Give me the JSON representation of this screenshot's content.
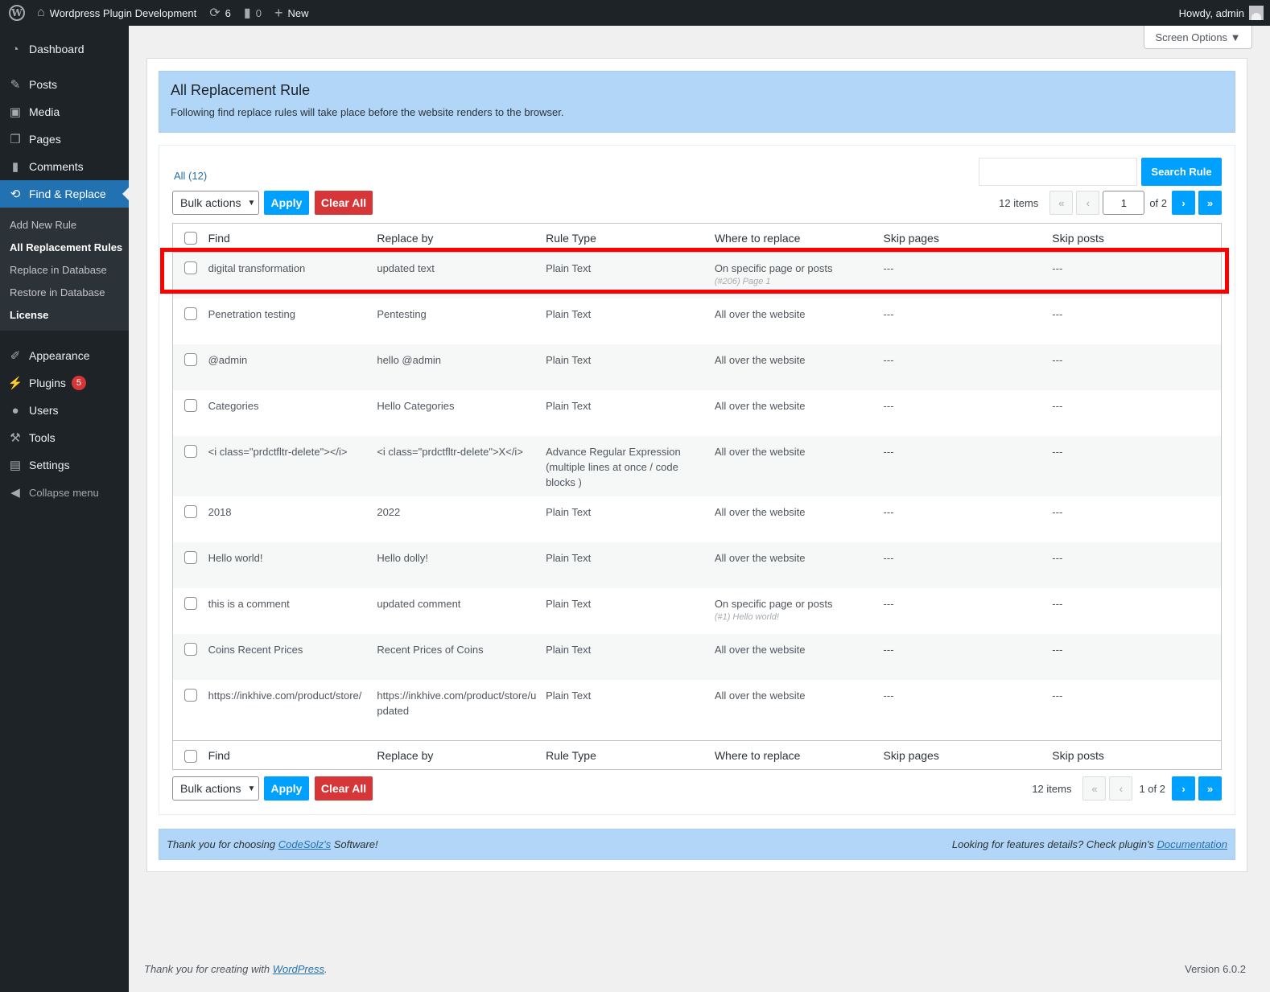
{
  "adminbar": {
    "site_name": "Wordpress Plugin Development",
    "updates_count": "6",
    "comments_count": "0",
    "new_label": "New",
    "howdy": "Howdy, admin"
  },
  "sidebar": {
    "dashboard": "Dashboard",
    "posts": "Posts",
    "media": "Media",
    "pages": "Pages",
    "comments": "Comments",
    "find_replace": "Find & Replace",
    "sub": [
      "Add New Rule",
      "All Replacement Rules",
      "Replace in Database",
      "Restore in Database",
      "License"
    ],
    "appearance": "Appearance",
    "plugins": "Plugins",
    "plugins_badge": "5",
    "users": "Users",
    "tools": "Tools",
    "settings": "Settings",
    "collapse": "Collapse menu"
  },
  "screen_options": "Screen Options ▼",
  "header": {
    "title": "All Replacement Rule",
    "description": "Following find replace rules will take place before the website renders to the browser."
  },
  "filters": {
    "all_label": "All (12)",
    "search_button": "Search Rule",
    "bulk_actions": "Bulk actions",
    "apply": "Apply",
    "clear_all": "Clear All"
  },
  "pagination": {
    "items": "12 items",
    "first": "«",
    "prev": "‹",
    "next": "›",
    "last": "»",
    "current_page": "1",
    "of_total": "of 2",
    "bottom_page": "1 of 2"
  },
  "table": {
    "columns": [
      "Find",
      "Replace by",
      "Rule Type",
      "Where to replace",
      "Skip pages",
      "Skip posts"
    ],
    "rows": [
      {
        "find": "digital transformation",
        "replace": "updated text",
        "type": "Plain Text",
        "where": "On specific page or posts",
        "where_note": "(#206) Page 1",
        "skip_pages": "---",
        "skip_posts": "---"
      },
      {
        "find": "Penetration testing",
        "replace": "Pentesting",
        "type": "Plain Text",
        "where": "All over the website",
        "where_note": "",
        "skip_pages": "---",
        "skip_posts": "---"
      },
      {
        "find": "@admin",
        "replace": "hello @admin",
        "type": "Plain Text",
        "where": "All over the website",
        "where_note": "",
        "skip_pages": "---",
        "skip_posts": "---"
      },
      {
        "find": "Categories",
        "replace": "Hello Categories",
        "type": "Plain Text",
        "where": "All over the website",
        "where_note": "",
        "skip_pages": "---",
        "skip_posts": "---"
      },
      {
        "find": "<i class=\"prdctfltr-delete\"></i>",
        "replace": "<i class=\"prdctfltr-delete\">X</i>",
        "type": "Advance Regular Expression (multiple lines at once / code blocks )",
        "where": "All over the website",
        "where_note": "",
        "skip_pages": "---",
        "skip_posts": "---"
      },
      {
        "find": "2018",
        "replace": "2022",
        "type": "Plain Text",
        "where": "All over the website",
        "where_note": "",
        "skip_pages": "---",
        "skip_posts": "---"
      },
      {
        "find": "Hello world!",
        "replace": "Hello dolly!",
        "type": "Plain Text",
        "where": "All over the website",
        "where_note": "",
        "skip_pages": "---",
        "skip_posts": "---"
      },
      {
        "find": "this is a comment",
        "replace": "updated comment",
        "type": "Plain Text",
        "where": "On specific page or posts",
        "where_note": "(#1) Hello world!",
        "skip_pages": "---",
        "skip_posts": "---"
      },
      {
        "find": "Coins Recent Prices",
        "replace": "Recent Prices of Coins",
        "type": "Plain Text",
        "where": "All over the website",
        "where_note": "",
        "skip_pages": "---",
        "skip_posts": "---"
      },
      {
        "find": "https://inkhive.com/product/store/",
        "replace": "https://inkhive.com/product/store/updated",
        "type": "Plain Text",
        "where": "All over the website",
        "where_note": "",
        "skip_pages": "---",
        "skip_posts": "---"
      }
    ]
  },
  "footer_box": {
    "left_prefix": "Thank you for choosing ",
    "left_link": "CodeSolz's",
    "left_suffix": " Software!",
    "right_prefix": "Looking for features details? Check plugin's ",
    "right_link": "Documentation"
  },
  "wp_footer": {
    "left_prefix": "Thank you for creating with ",
    "left_link": "WordPress",
    "left_suffix": ".",
    "version": "Version 6.0.2"
  },
  "colors": {
    "accent": "#00a0ff",
    "danger": "#d63638",
    "highlight": "#ff0000",
    "header_bg": "#b1d6f7"
  }
}
